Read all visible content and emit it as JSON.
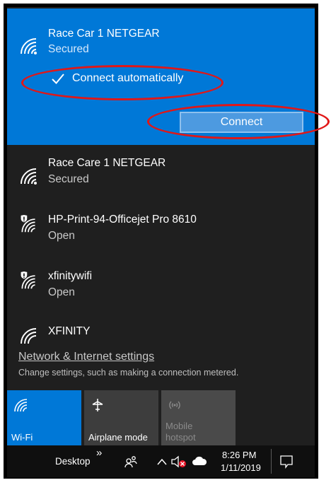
{
  "networks": [
    {
      "name": "Race Car 1 NETGEAR",
      "status": "Secured",
      "icon": "wifi-secured-icon"
    },
    {
      "name": "Race Care 1 NETGEAR",
      "status": "Secured",
      "icon": "wifi-secured-icon"
    },
    {
      "name": "HP-Print-94-Officejet Pro 8610",
      "status": "Open",
      "icon": "wifi-open-shield-icon"
    },
    {
      "name": "xfinitywifi",
      "status": "Open",
      "icon": "wifi-open-shield-icon"
    },
    {
      "name": "XFINITY",
      "status": "",
      "icon": "wifi-secured-icon"
    }
  ],
  "selected": {
    "connect_automatically_label": "Connect automatically",
    "connect_automatically_checked": true,
    "connect_button_label": "Connect"
  },
  "settings": {
    "link_label": "Network & Internet settings",
    "description": "Change settings, such as making a connection metered."
  },
  "quick_actions": [
    {
      "label": "Wi-Fi",
      "state": "on",
      "icon": "wifi-icon"
    },
    {
      "label": "Airplane mode",
      "state": "off",
      "icon": "airplane-icon"
    },
    {
      "label": "Mobile\nhotspot",
      "label_line1": "Mobile",
      "label_line2": "hotspot",
      "state": "disabled",
      "icon": "hotspot-icon"
    }
  ],
  "taskbar": {
    "desktop_label": "Desktop",
    "overflow_label": "»",
    "time": "8:26 PM",
    "date": "1/11/2019"
  },
  "colors": {
    "accent": "#0078d7",
    "flyout_background": "#1f1f1f",
    "annotation": "#e11717"
  }
}
